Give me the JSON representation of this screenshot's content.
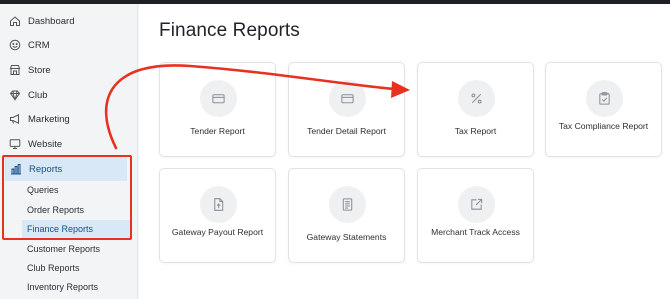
{
  "sidebar": {
    "items": [
      {
        "label": "Dashboard",
        "icon": "home-icon"
      },
      {
        "label": "CRM",
        "icon": "smiley-icon"
      },
      {
        "label": "Store",
        "icon": "store-icon"
      },
      {
        "label": "Club",
        "icon": "diamond-icon"
      },
      {
        "label": "Marketing",
        "icon": "megaphone-icon"
      },
      {
        "label": "Website",
        "icon": "monitor-icon"
      },
      {
        "label": "Reports",
        "icon": "bar-chart-icon",
        "active": true
      }
    ],
    "sub_items": [
      {
        "label": "Queries"
      },
      {
        "label": "Order Reports"
      },
      {
        "label": "Finance Reports",
        "active": true
      },
      {
        "label": "Customer Reports"
      },
      {
        "label": "Club Reports"
      },
      {
        "label": "Inventory Reports"
      }
    ]
  },
  "main": {
    "title": "Finance Reports",
    "cards": [
      {
        "label": "Tender Report",
        "icon": "card-icon"
      },
      {
        "label": "Tender Detail Report",
        "icon": "card-icon"
      },
      {
        "label": "Tax Report",
        "icon": "percent-icon"
      },
      {
        "label": "Tax Compliance Report",
        "icon": "clipboard-check-icon"
      },
      {
        "label": "Gateway Payout Report",
        "icon": "file-upload-icon"
      },
      {
        "label": "Gateway Statements",
        "icon": "document-lines-icon"
      },
      {
        "label": "Merchant Track Access",
        "icon": "external-link-icon"
      }
    ]
  },
  "colors": {
    "accent": "#1a4f86",
    "active_bg": "#d8e8f6",
    "annotation_red": "#e8311f"
  }
}
